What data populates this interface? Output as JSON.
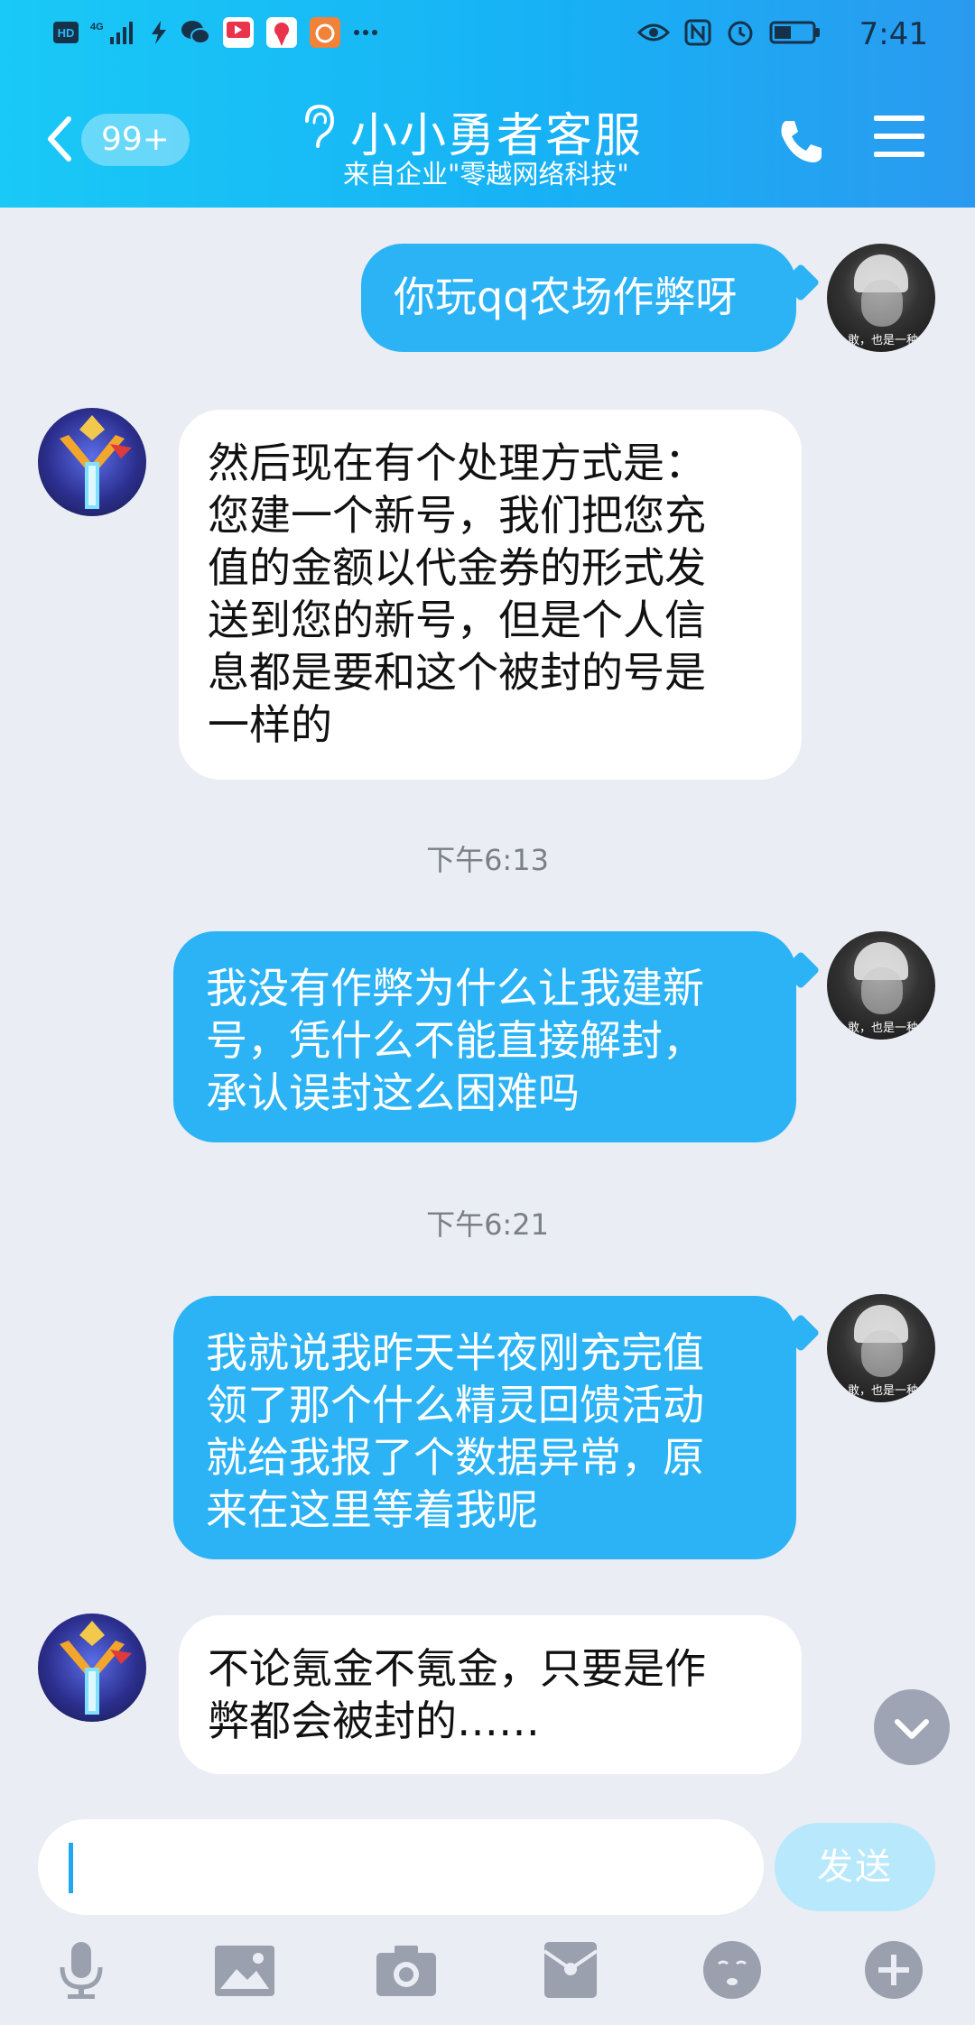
{
  "status_bar": {
    "time": "7:41",
    "network": "4G",
    "battery_level": 0.45,
    "notification_icons": [
      "hd-icon",
      "signal-icon",
      "bolt-icon",
      "wechat-icon",
      "video-app-icon",
      "pin-app-icon",
      "uc-app-icon",
      "more-dots-icon"
    ],
    "status_icons": [
      "eye-icon",
      "nfc-icon",
      "alarm-icon",
      "battery-icon"
    ]
  },
  "header": {
    "unread_badge": "99+",
    "title": "小小勇者客服",
    "subtitle": "来自企业\"零越网络科技\""
  },
  "messages": [
    {
      "from": "me",
      "text": "你玩qq农场作弊呀"
    },
    {
      "from": "cs",
      "text": "然后现在有个处理方式是：\n您建一个新号，我们把您充\n值的金额以代金券的形式发\n送到您的新号，但是个人信\n息都是要和这个被封的号是\n一样的"
    },
    {
      "from": "time",
      "text": "下午6:13"
    },
    {
      "from": "me",
      "text": "我没有作弊为什么让我建新\n号，凭什么不能直接解封，\n承认误封这么困难吗"
    },
    {
      "from": "time",
      "text": "下午6:21"
    },
    {
      "from": "me",
      "text": "我就说我昨天半夜刚充完值\n领了那个什么精灵回馈活动\n就给我报了个数据异常，原\n来在这里等着我呢"
    },
    {
      "from": "cs",
      "text": "不论氪金不氪金，只要是作\n弊都会被封的……"
    }
  ],
  "input": {
    "value": "",
    "send_label": "发送"
  },
  "toolbar": [
    "microphone-icon",
    "image-icon",
    "camera-icon",
    "red-packet-icon",
    "emoji-icon",
    "plus-icon"
  ],
  "colors": {
    "header_start": "#19c9f6",
    "header_end": "#2a9af0",
    "my_bubble": "#2cb3f5",
    "their_bubble": "#ffffff",
    "background": "#eaedf4",
    "send_disabled": "#b8e8fc"
  }
}
